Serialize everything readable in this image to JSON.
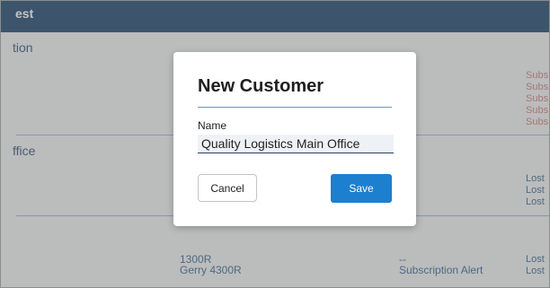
{
  "header": {
    "title": "est"
  },
  "groups": [
    {
      "label": "tion"
    },
    {
      "label": "ffice"
    }
  ],
  "right_column": {
    "group1": [
      "Subs",
      "Subs",
      "Subs",
      "Subs",
      "Subs"
    ],
    "group2": [
      "Lost",
      "Lost",
      "Lost"
    ],
    "group3": [
      "Lost",
      "Lost"
    ]
  },
  "rows": [
    {
      "code": "1300R",
      "status": "--"
    },
    {
      "code": "Gerry 4300R",
      "status": "Subscription Alert"
    }
  ],
  "modal": {
    "title": "New Customer",
    "field_label": "Name",
    "name_value": "Quality Logistics Main Office",
    "cancel_label": "Cancel",
    "save_label": "Save"
  },
  "colors": {
    "header": "#0c3a63",
    "accent": "#1c7fd0",
    "alert_text": "#c47b76"
  }
}
